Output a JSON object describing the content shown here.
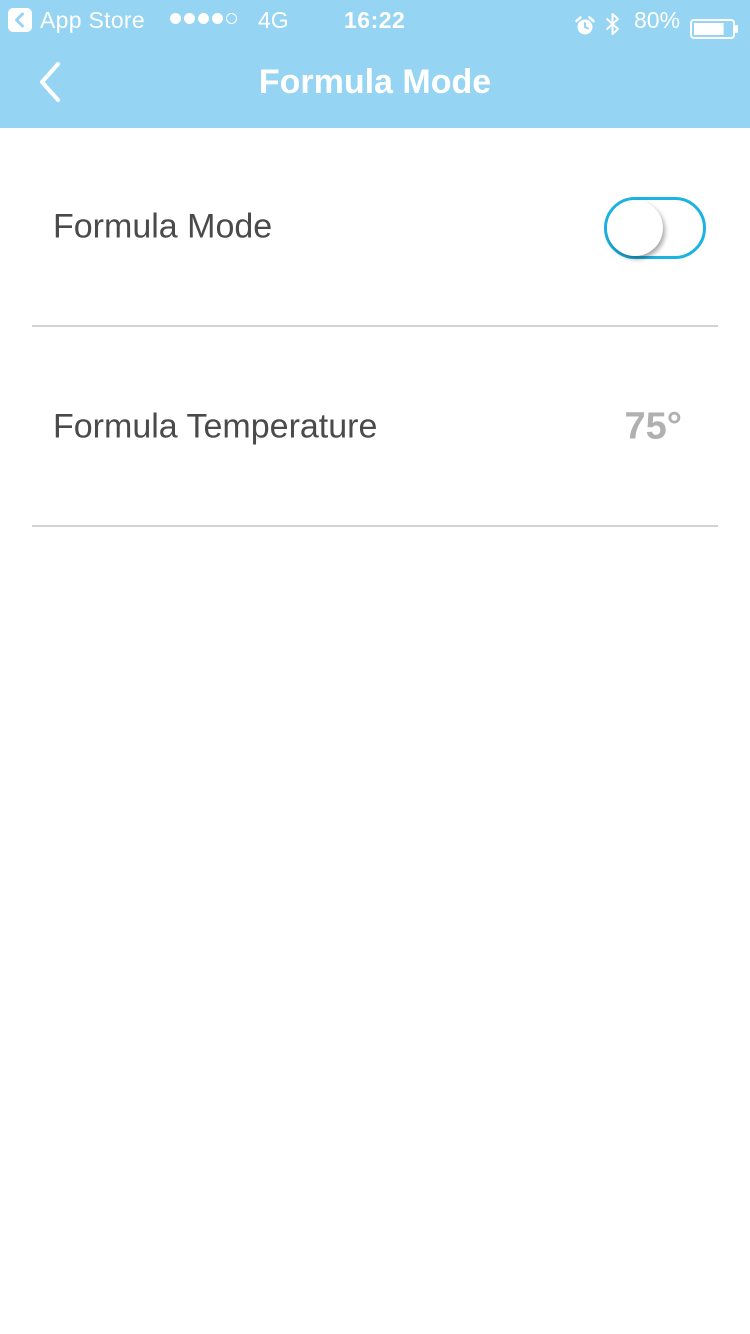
{
  "status_bar": {
    "back_app": "App Store",
    "signal_filled": 4,
    "signal_total": 5,
    "network": "4G",
    "time": "16:22",
    "battery_percent": "80%",
    "battery_level": 0.8,
    "icons": [
      "back-arrow-icon",
      "alarm-icon",
      "bluetooth-icon",
      "battery-icon"
    ]
  },
  "nav": {
    "title": "Formula Mode",
    "back_icon": "chevron-left-icon"
  },
  "settings": {
    "formula_mode": {
      "label": "Formula Mode",
      "enabled": false
    },
    "formula_temperature": {
      "label": "Formula Temperature",
      "value": "75°"
    }
  },
  "colors": {
    "header_bg": "#95d4f2",
    "toggle_accent": "#1cb3e3",
    "label_text": "#4a4a4a",
    "value_text": "#b0b0b0",
    "divider": "#d2d2d2"
  }
}
